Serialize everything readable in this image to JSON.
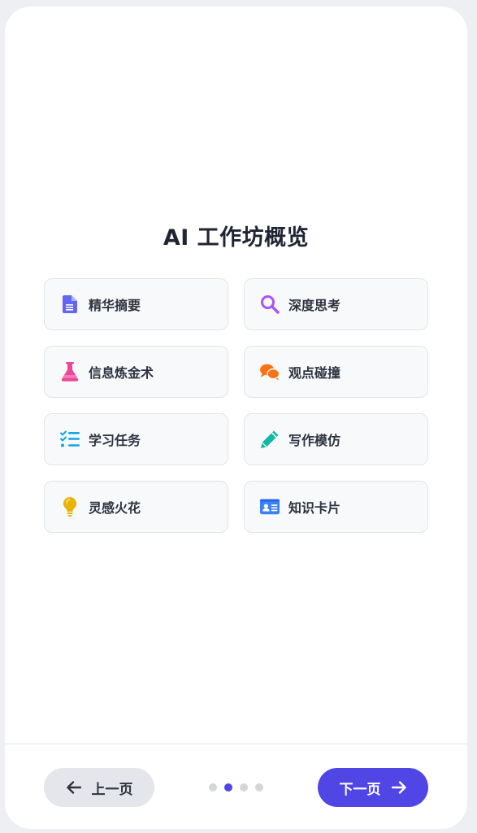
{
  "page": {
    "title": "AI 工作坊概览"
  },
  "cards": [
    {
      "label": "精华摘要",
      "icon": "document-icon",
      "color": "#6366f1"
    },
    {
      "label": "深度思考",
      "icon": "magnifier-icon",
      "color": "#a855f7"
    },
    {
      "label": "信息炼金术",
      "icon": "flask-icon",
      "color": "#ec4899"
    },
    {
      "label": "观点碰撞",
      "icon": "chat-bubbles-icon",
      "color": "#f97316"
    },
    {
      "label": "学习任务",
      "icon": "task-list-icon",
      "color": "#0ea5e9"
    },
    {
      "label": "写作模仿",
      "icon": "pencil-icon",
      "color": "#14b8a6"
    },
    {
      "label": "灵感火花",
      "icon": "lightbulb-icon",
      "color": "#eab308"
    },
    {
      "label": "知识卡片",
      "icon": "id-card-icon",
      "color": "#3b82f6"
    }
  ],
  "nav": {
    "prev_label": "上一页",
    "next_label": "下一页",
    "accent_color": "#4f46e5",
    "page_count": 4,
    "current_page": 2
  }
}
